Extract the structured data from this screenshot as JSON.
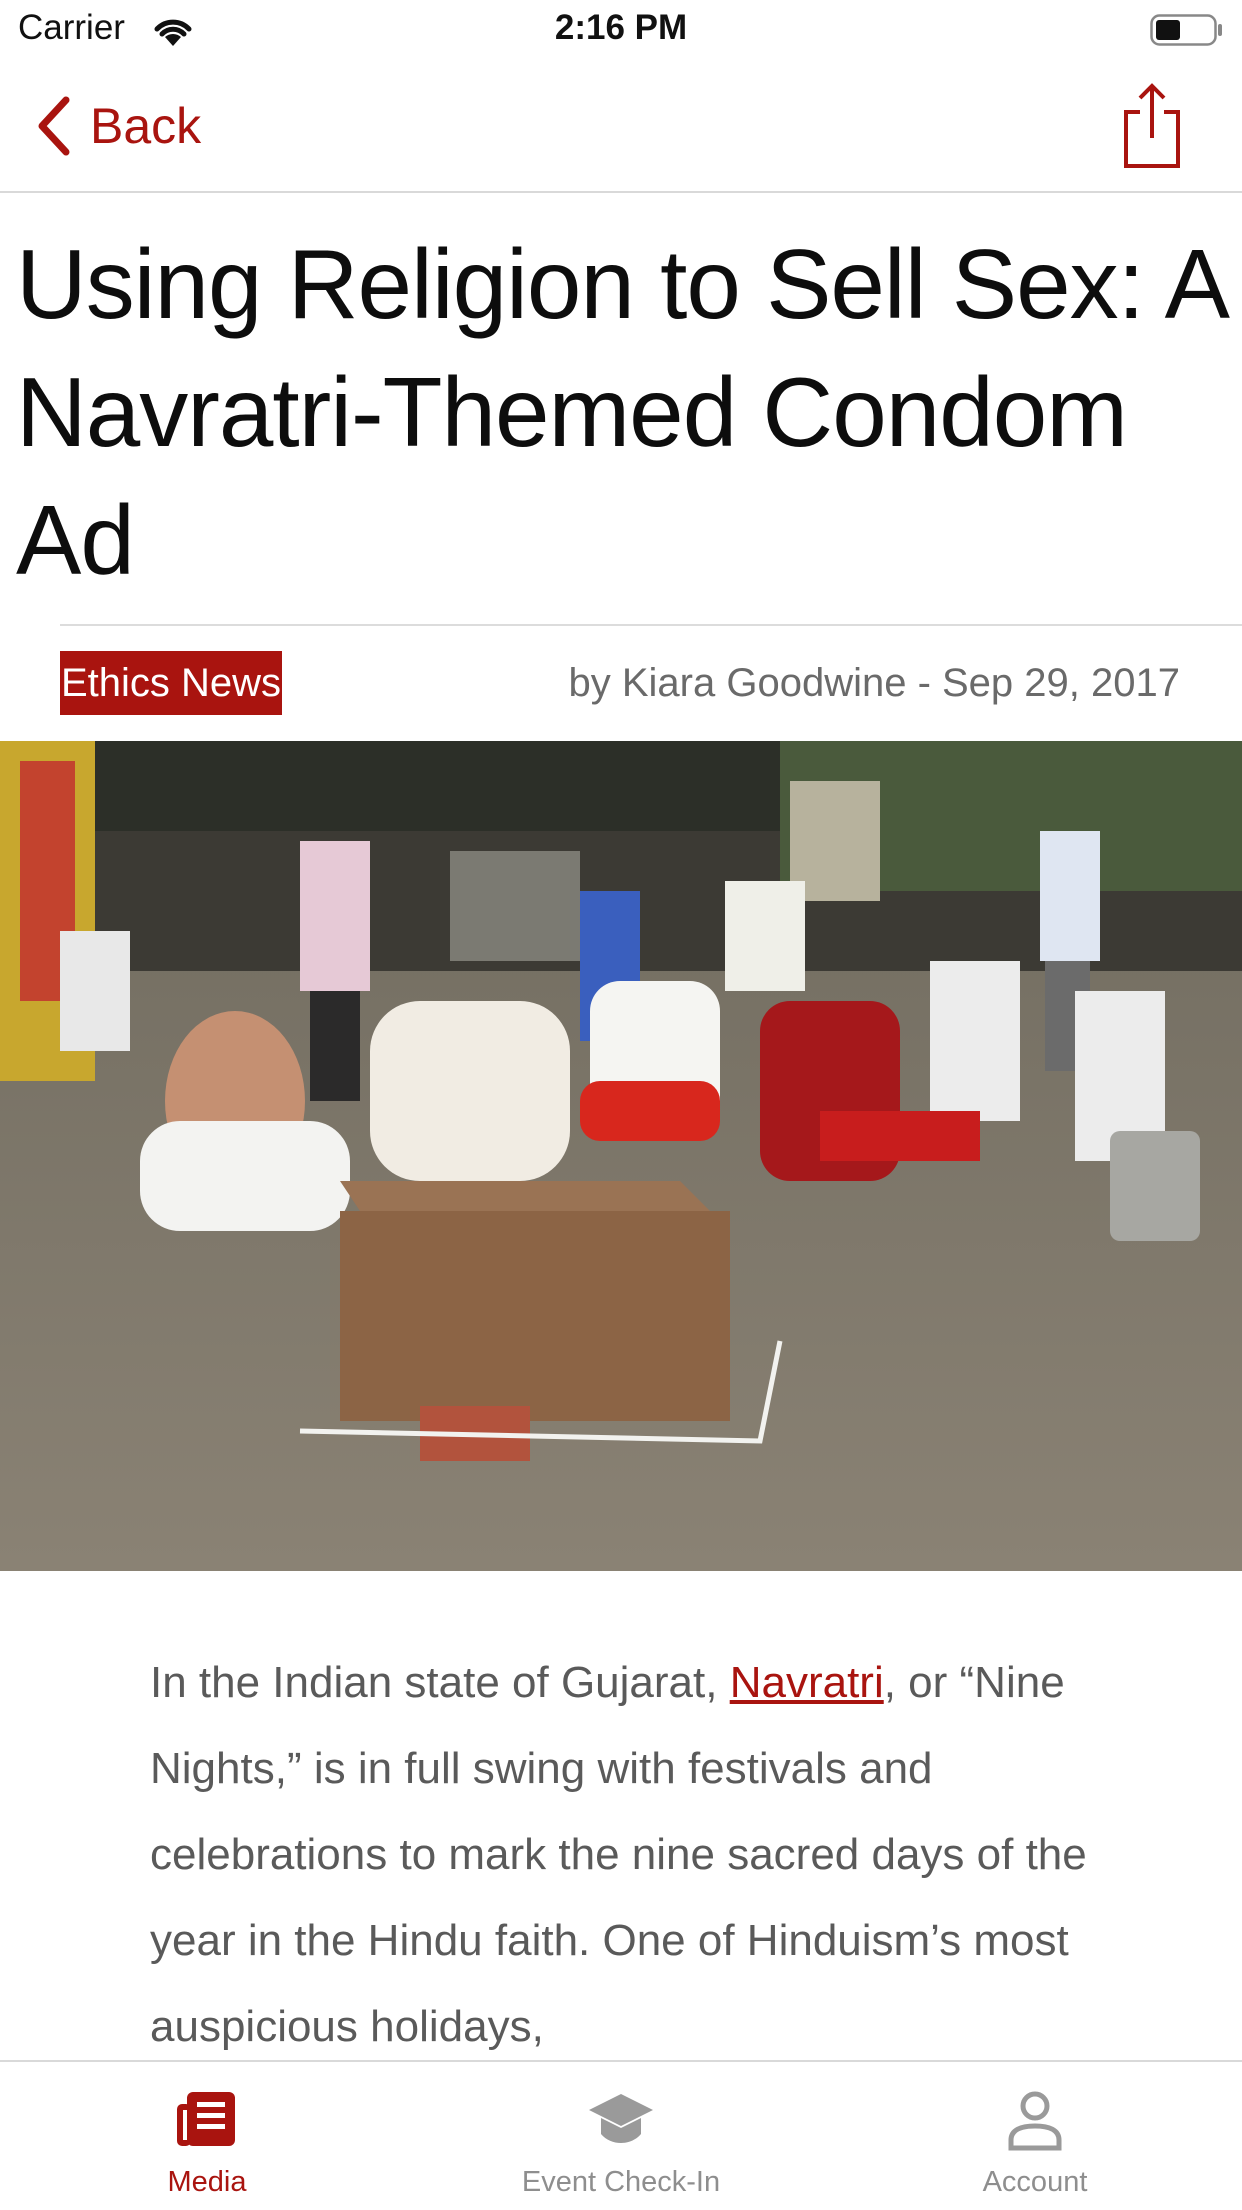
{
  "status_bar": {
    "carrier": "Carrier",
    "time": "2:16 PM"
  },
  "nav": {
    "back_label": "Back"
  },
  "article": {
    "title": "Using Religion to Sell Sex: A Navratri-Themed Condom Ad",
    "category": "Ethics News",
    "byline": "by Kiara Goodwine - Sep 29, 2017",
    "body_before_link": "In the Indian state of Gujarat, ",
    "body_link": "Navratri",
    "body_after_link": ", or “Nine Nights,” is in full swing with festivals and celebrations to mark the nine sacred days of the year in the Hindu faith. One of Hinduism’s most auspicious holidays,"
  },
  "tabs": [
    {
      "label": "Media",
      "icon": "newspaper-icon",
      "active": true
    },
    {
      "label": "Event Check-In",
      "icon": "graduation-cap-icon",
      "active": false
    },
    {
      "label": "Account",
      "icon": "person-icon",
      "active": false
    }
  ],
  "colors": {
    "accent": "#a9140f",
    "inactive": "#8e8e8e",
    "divider": "#d9d9d9"
  }
}
